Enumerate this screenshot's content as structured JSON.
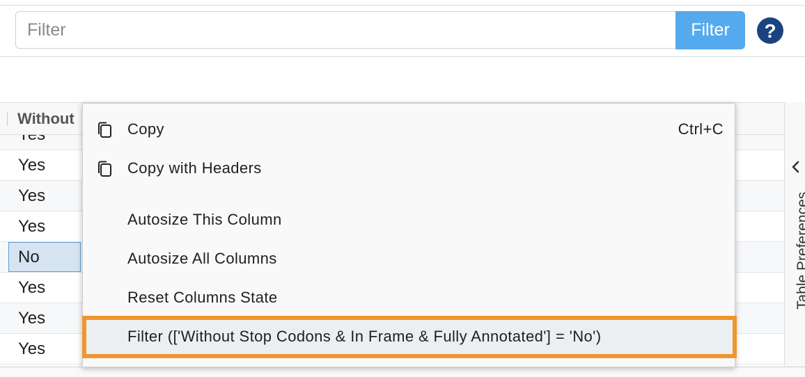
{
  "filter_bar": {
    "placeholder": "Filter",
    "button_label": "Filter",
    "help_icon": "question-circle-icon"
  },
  "grid": {
    "column_header": "Without Stop Codons & In Frame & Fully Annotated",
    "column_header_visible": "Without",
    "rows": [
      "Yes",
      "Yes",
      "Yes",
      "Yes",
      "No",
      "Yes",
      "Yes",
      "Yes"
    ],
    "selected_row": 4
  },
  "side_panel": {
    "label": "Table Preferences",
    "chevron_icon": "chevron-left-icon"
  },
  "context_menu": {
    "items": [
      {
        "label": "Copy",
        "shortcut": "Ctrl+C",
        "icon": "copy-icon"
      },
      {
        "label": "Copy with Headers",
        "shortcut": "",
        "icon": "copy-icon"
      },
      {
        "label": "Autosize This Column",
        "shortcut": "",
        "icon": ""
      },
      {
        "label": "Autosize All Columns",
        "shortcut": "",
        "icon": ""
      },
      {
        "label": "Reset Columns State",
        "shortcut": "",
        "icon": ""
      },
      {
        "label": "Filter (['Without Stop Codons & In Frame & Fully Annotated'] = 'No')",
        "shortcut": "",
        "icon": ""
      }
    ],
    "highlighted_index": 5
  },
  "colors": {
    "accent": "#55aaee",
    "help_icon": "#1a4480",
    "highlight_border": "#f0962e",
    "selected_cell": "#d6e4f2"
  }
}
